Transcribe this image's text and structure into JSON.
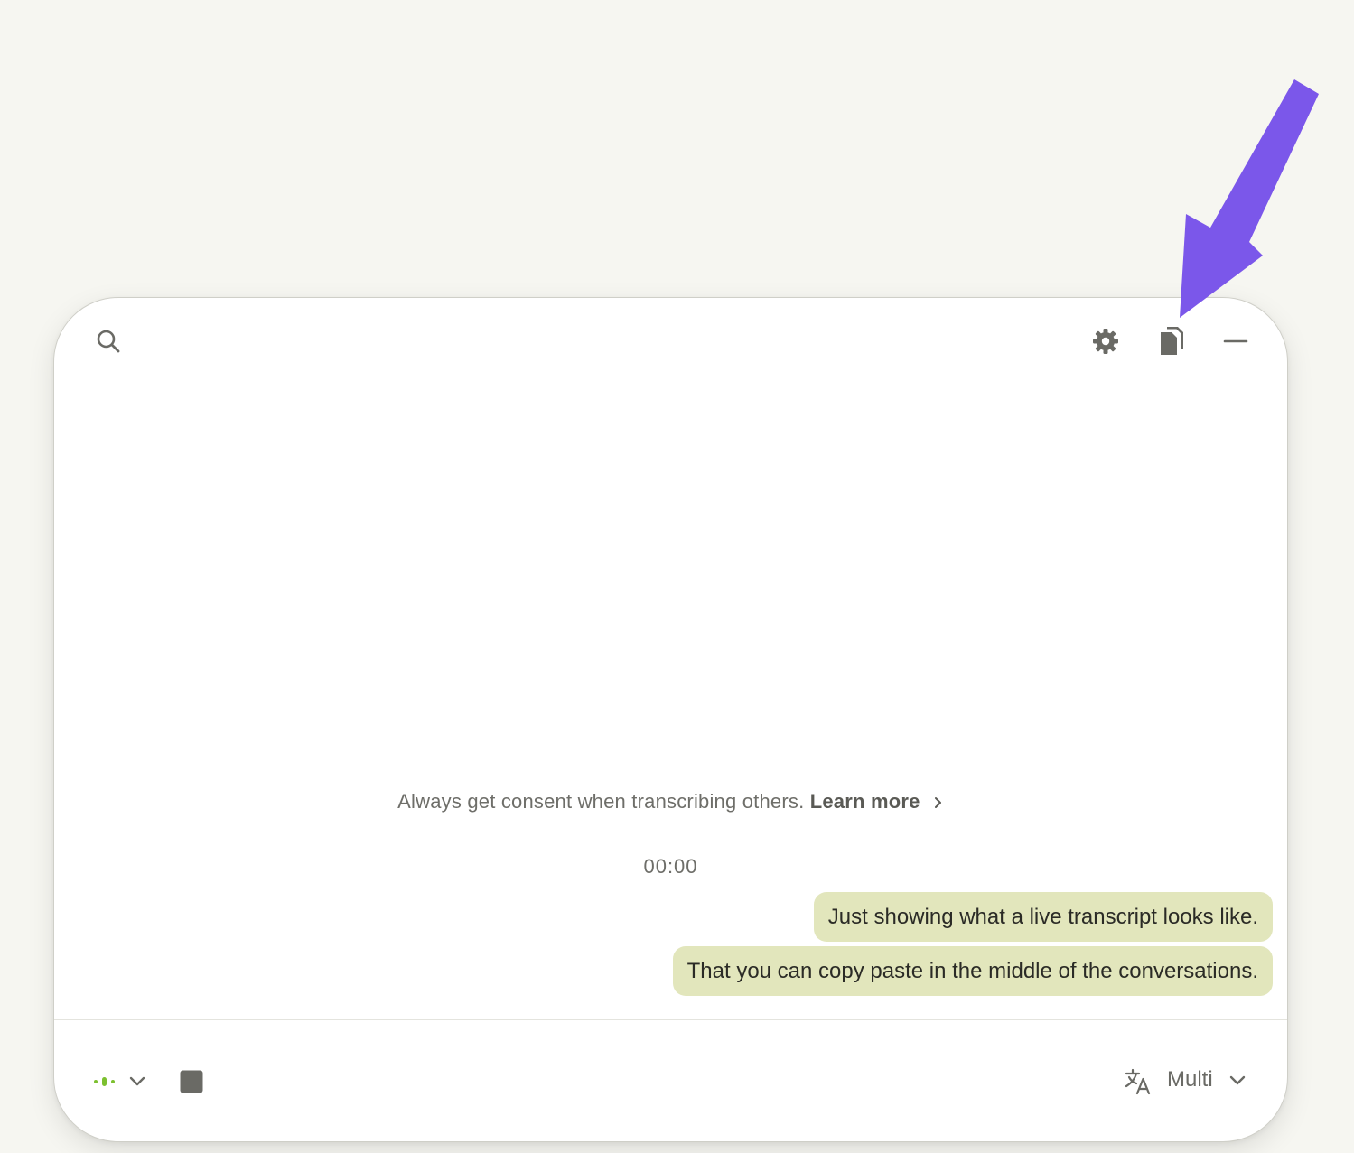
{
  "consent": {
    "text": "Always get consent when transcribing others.",
    "link_label": "Learn more"
  },
  "timer": "00:00",
  "transcript": [
    "Just showing what a live transcript looks like.",
    "That you can copy paste in the middle of the conversations."
  ],
  "footer": {
    "language_label": "Multi"
  },
  "colors": {
    "accent_arrow": "#7b57ea",
    "bubble": "#e2e6bc",
    "mic_active": "#7cc02f",
    "icon": "#6a6a65"
  },
  "icons": {
    "search": "search-icon",
    "settings": "gear-icon",
    "copy": "copy-icon",
    "minimize": "minimize-icon",
    "mic": "microphone-level-icon",
    "stop": "stop-icon",
    "translate": "translate-icon",
    "chevron": "chevron-down-icon"
  }
}
